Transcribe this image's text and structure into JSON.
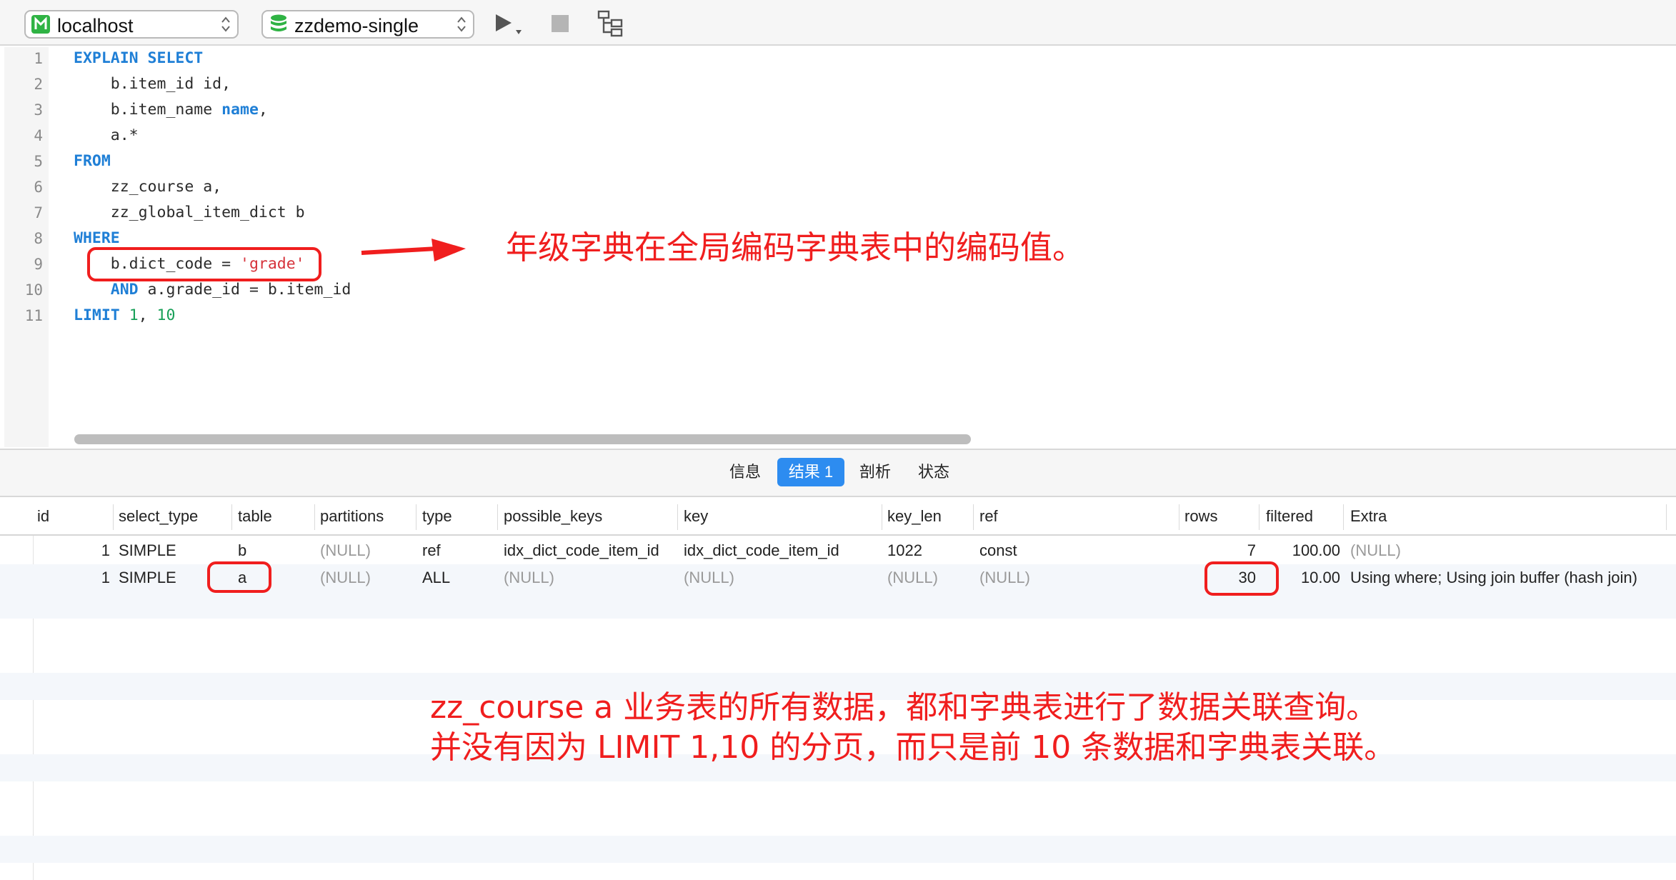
{
  "toolbar": {
    "connection": "localhost",
    "database": "zzdemo-single"
  },
  "editor": {
    "line_numbers": [
      "1",
      "2",
      "3",
      "4",
      "5",
      "6",
      "7",
      "8",
      "9",
      "10",
      "11"
    ],
    "l1_kw": "EXPLAIN SELECT",
    "l2_text": "    b.item_id id,",
    "l3_text": "    b.item_name ",
    "l3_kw": "name",
    "l3_tail": ",",
    "l4_text": "    a.*",
    "l5_kw": "FROM",
    "l6_text": "    zz_course a,",
    "l7_text": "    zz_global_item_dict b",
    "l8_kw": "WHERE",
    "l9_text": "    b.dict_code = ",
    "l9_str": "'grade'",
    "l10_kw": "    AND",
    "l10_text": " a.grade_id = b.item_id",
    "l11_kw": "LIMIT",
    "l11_num1": "1",
    "l11_sep": ", ",
    "l11_num2": "10"
  },
  "annotations": {
    "top_note": "年级字典在全局编码字典表中的编码值。",
    "bottom_note_1": "zz_course a 业务表的所有数据，都和字典表进行了数据关联查询。",
    "bottom_note_2": "并没有因为 LIMIT 1,10 的分页，而只是前 10 条数据和字典表关联。",
    "accent": "#f01e1e"
  },
  "tabs": [
    {
      "label": "信息"
    },
    {
      "label": "结果 1"
    },
    {
      "label": "剖析"
    },
    {
      "label": "状态"
    }
  ],
  "grid": {
    "columns": [
      "id",
      "select_type",
      "table",
      "partitions",
      "type",
      "possible_keys",
      "key",
      "key_len",
      "ref",
      "rows",
      "filtered",
      "Extra"
    ],
    "rows": [
      [
        "1",
        "SIMPLE",
        "b",
        "(NULL)",
        "ref",
        "idx_dict_code_item_id",
        "idx_dict_code_item_id",
        "1022",
        "const",
        "7",
        "100.00",
        "(NULL)"
      ],
      [
        "1",
        "SIMPLE",
        "a",
        "(NULL)",
        "ALL",
        "(NULL)",
        "(NULL)",
        "(NULL)",
        "(NULL)",
        "30",
        "10.00",
        "Using where; Using join buffer (hash join)"
      ]
    ]
  }
}
